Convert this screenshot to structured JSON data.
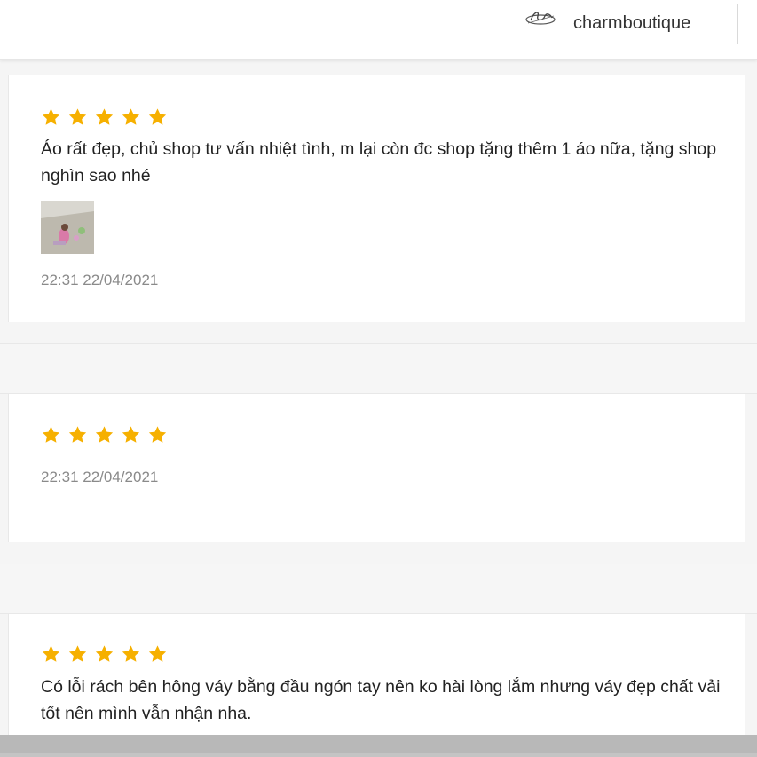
{
  "header": {
    "shop_name": "charmboutique",
    "logo_icon": "shop-logo-icon"
  },
  "reviews": [
    {
      "rating": 5,
      "text": "Áo rất đẹp, chủ shop tư vấn nhiệt tình, m lại còn đc shop tặng thêm 1 áo nữa, tặng shop nghìn sao nhé",
      "has_image": true,
      "timestamp": "22:31 22/04/2021"
    },
    {
      "rating": 5,
      "text": "",
      "has_image": false,
      "timestamp": "22:31 22/04/2021"
    },
    {
      "rating": 5,
      "text": "Có lỗi rách bên hông váy bằng đầu ngón tay nên ko hài lòng lắm nhưng váy đẹp chất vải tốt nên mình vẫn nhận nha.",
      "has_image": false,
      "timestamp": ""
    }
  ],
  "colors": {
    "star": "#f6b000",
    "text": "#222222",
    "timestamp": "#8a8a8a"
  }
}
